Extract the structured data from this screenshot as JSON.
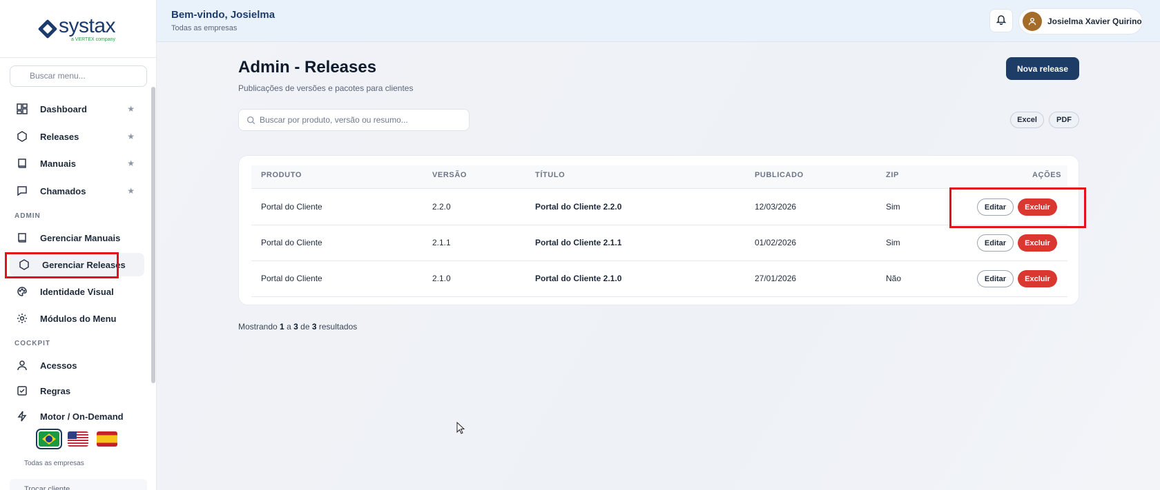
{
  "sidebar": {
    "logo_word": "systax",
    "logo_sub": "a VERTEX company",
    "search_placeholder": "Buscar menu...",
    "items": [
      {
        "label": "Dashboard",
        "icon": "dashboard-icon",
        "starred": true
      },
      {
        "label": "Releases",
        "icon": "hexagon-icon",
        "starred": true
      },
      {
        "label": "Manuais",
        "icon": "book-icon",
        "starred": true
      },
      {
        "label": "Chamados",
        "icon": "chat-icon",
        "starred": true
      }
    ],
    "admin_label": "ADMIN",
    "admin_items": [
      {
        "label": "Gerenciar Manuais",
        "icon": "book-icon"
      },
      {
        "label": "Gerenciar Releases",
        "icon": "hexagon-icon",
        "active": true
      },
      {
        "label": "Identidade Visual",
        "icon": "palette-icon"
      },
      {
        "label": "Módulos do Menu",
        "icon": "gear-icon"
      }
    ],
    "cockpit_label": "COCKPIT",
    "cockpit_items": [
      {
        "label": "Acessos",
        "icon": "user-icon"
      },
      {
        "label": "Regras",
        "icon": "checkbox-icon"
      },
      {
        "label": "Motor / On-Demand",
        "icon": "lightning-icon"
      }
    ],
    "languages": [
      "pt-BR",
      "en-US",
      "es-ES"
    ],
    "footer_company": "Todas as empresas",
    "switch_client": "Trocar cliente"
  },
  "header": {
    "welcome": "Bem-vindo, Josielma",
    "subtitle": "Todas as empresas",
    "user_name": "Josielma Xavier Quirino"
  },
  "page": {
    "title": "Admin - Releases",
    "subtitle": "Publicações de versões e pacotes para clientes",
    "new_button": "Nova release",
    "search_placeholder": "Buscar por produto, versão ou resumo...",
    "export_excel": "Excel",
    "export_pdf": "PDF"
  },
  "table": {
    "columns": [
      "PRODUTO",
      "VERSÃO",
      "TÍTULO",
      "PUBLICADO",
      "ZIP",
      "AÇÕES"
    ],
    "rows": [
      {
        "produto": "Portal do Cliente",
        "versao": "2.2.0",
        "titulo": "Portal do Cliente 2.2.0",
        "publicado": "12/03/2026",
        "zip": "Sim"
      },
      {
        "produto": "Portal do Cliente",
        "versao": "2.1.1",
        "titulo": "Portal do Cliente 2.1.1",
        "publicado": "01/02/2026",
        "zip": "Sim"
      },
      {
        "produto": "Portal do Cliente",
        "versao": "2.1.0",
        "titulo": "Portal do Cliente 2.1.0",
        "publicado": "27/01/2026",
        "zip": "Não"
      }
    ],
    "edit_label": "Editar",
    "delete_label": "Excluir"
  },
  "pagination": {
    "prefix": "Mostrando",
    "from": "1",
    "a": "a",
    "to": "3",
    "de": "de",
    "total": "3",
    "suffix": "resultados"
  },
  "colors": {
    "primary": "#1d3d66",
    "danger": "#d9372f",
    "highlight": "#e0131a"
  }
}
